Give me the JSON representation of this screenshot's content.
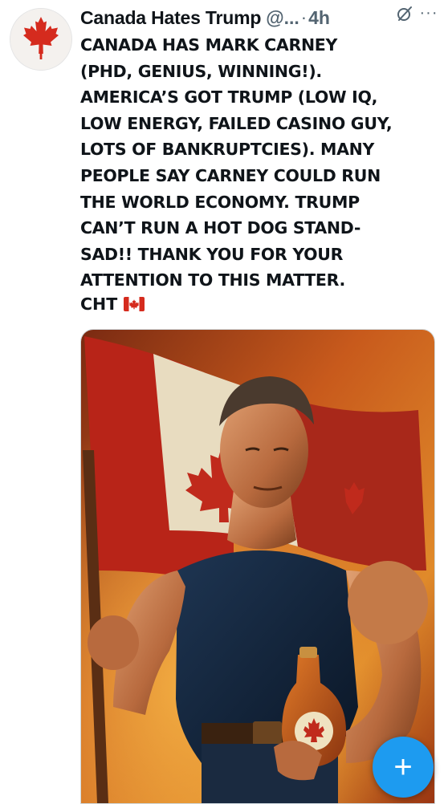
{
  "author": {
    "display_name": "Canada Hates Trump",
    "handle": "@...",
    "separator": "·",
    "time": "4h",
    "avatar_icon": "maple-leaf-icon"
  },
  "tweet": {
    "text": "CANADA HAS MARK CARNEY\n(PHD, GENIUS, WINNING!).\nAMERICA’S GOT TRUMP (LOW IQ,\nLOW ENERGY, FAILED CASINO GUY,\nLOTS OF BANKRUPTCIES). MANY\nPEOPLE SAY CARNEY COULD RUN\nTHE WORLD ECONOMY. TRUMP\nCAN’T RUN A HOT DOG STAND-\nSAD!! THANK YOU FOR YOUR\nATTENTION TO THIS MATTER.",
    "signature": "CHT",
    "signature_emoji": "canada-flag-emoji"
  },
  "actions": {
    "grok_icon": "grok-icon",
    "more_icon": "more-icon",
    "more_glyph": "···",
    "compose_icon": "plus-icon",
    "compose_glyph": "+"
  },
  "colors": {
    "accent": "#1d9bf0",
    "text": "#0f1419",
    "secondary": "#536471",
    "flag_red": "#d52b1e"
  }
}
